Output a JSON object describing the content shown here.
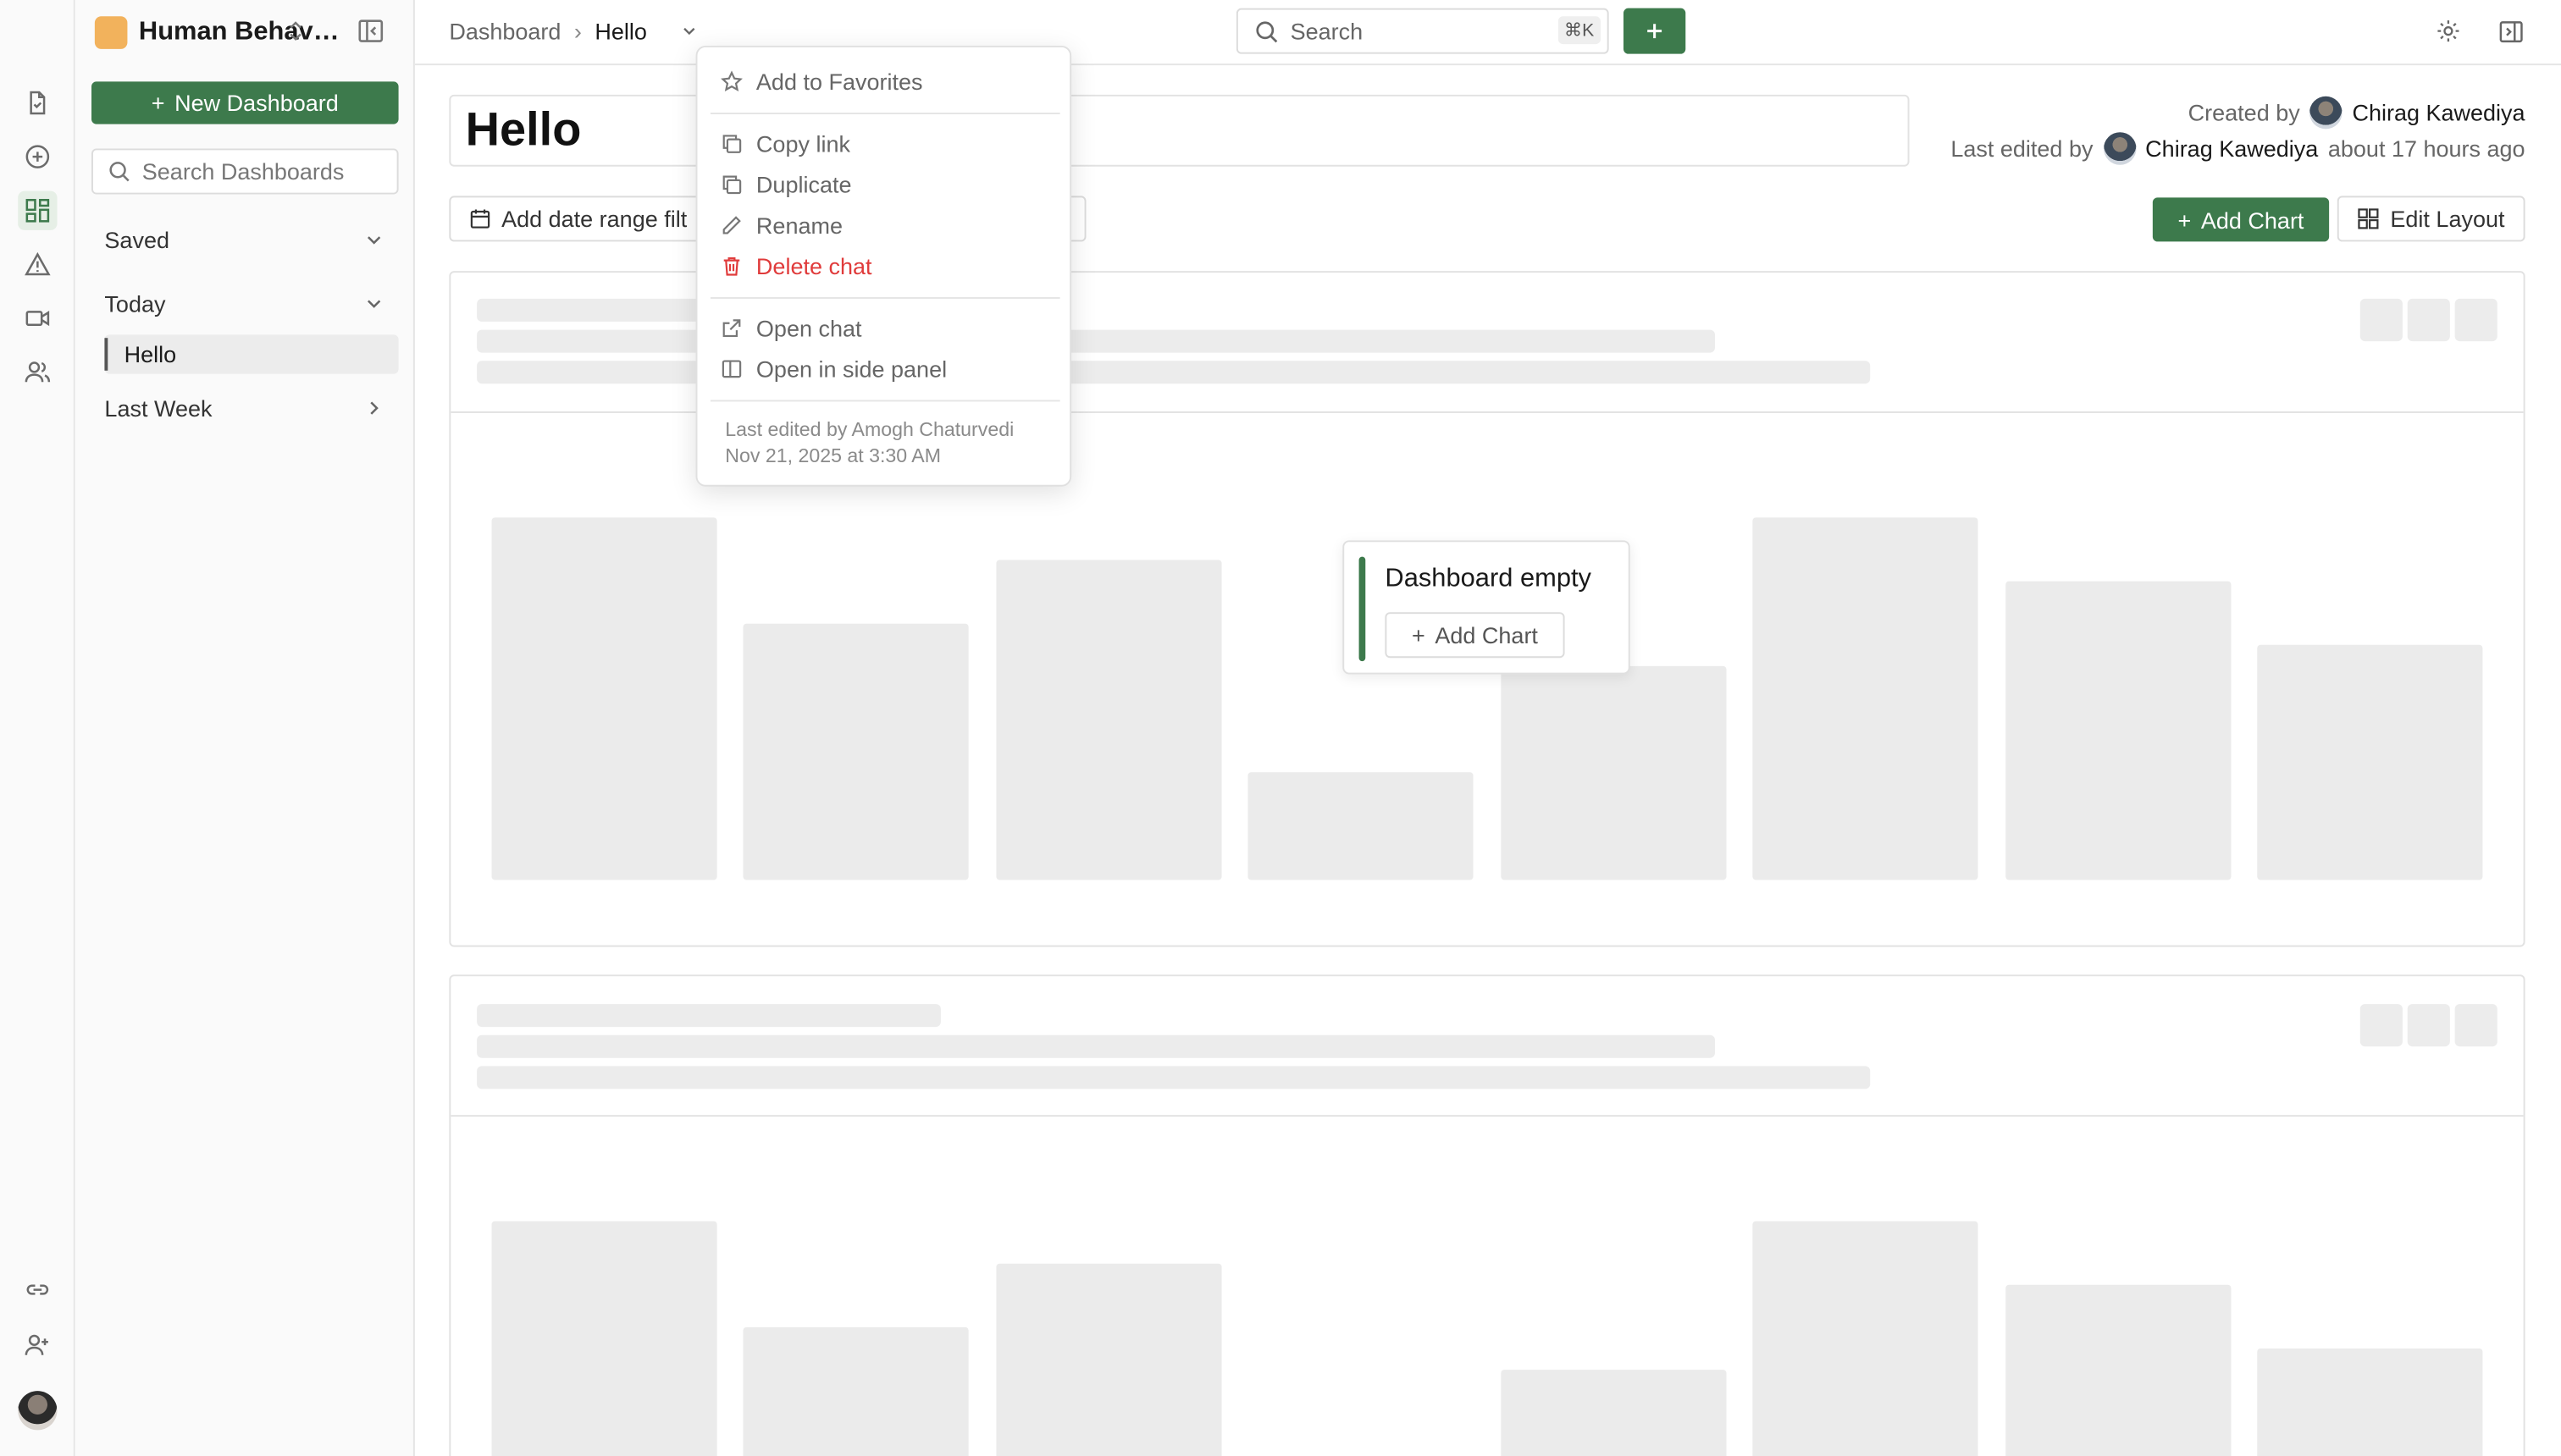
{
  "workspace": {
    "name": "Human Behavi..."
  },
  "sidebar": {
    "new_dashboard": "New Dashboard",
    "search_placeholder": "Search Dashboards",
    "groups": [
      {
        "label": "Saved",
        "state": "expanded"
      },
      {
        "label": "Today",
        "state": "expanded"
      },
      {
        "label": "Last Week",
        "state": "collapsed"
      }
    ],
    "today_items": [
      "Hello"
    ]
  },
  "breadcrumb": {
    "root": "Dashboard",
    "current": "Hello"
  },
  "search": {
    "placeholder": "Search",
    "shortcut": "⌘K"
  },
  "dashboard": {
    "title": "Hello",
    "created_label": "Created by",
    "created_by": "Chirag Kawediya",
    "edited_label": "Last edited by",
    "edited_by": "Chirag Kawediya",
    "edited_when": "about 17 hours ago",
    "filter_label": "Add date range filt",
    "add_chart": "Add Chart",
    "edit_layout": "Edit Layout"
  },
  "empty_state": {
    "title": "Dashboard empty",
    "button": "Add Chart"
  },
  "menu": {
    "items": [
      {
        "label": "Add to Favorites",
        "icon": "star-icon"
      },
      {
        "label": "Copy link",
        "icon": "copy-icon"
      },
      {
        "label": "Duplicate",
        "icon": "duplicate-icon"
      },
      {
        "label": "Rename",
        "icon": "pencil-icon"
      },
      {
        "label": "Delete chat",
        "icon": "trash-icon"
      },
      {
        "label": "Open chat",
        "icon": "external-link-icon"
      },
      {
        "label": "Open in side panel",
        "icon": "side-panel-icon"
      }
    ],
    "footer_line1": "Last edited by Amogh Chaturvedi",
    "footer_line2": "Nov 21, 2025 at 3:30 AM"
  },
  "colors": {
    "accent": "#3d7a4c",
    "danger": "#e03b3b",
    "workspace_logo": "#f2b25c"
  }
}
